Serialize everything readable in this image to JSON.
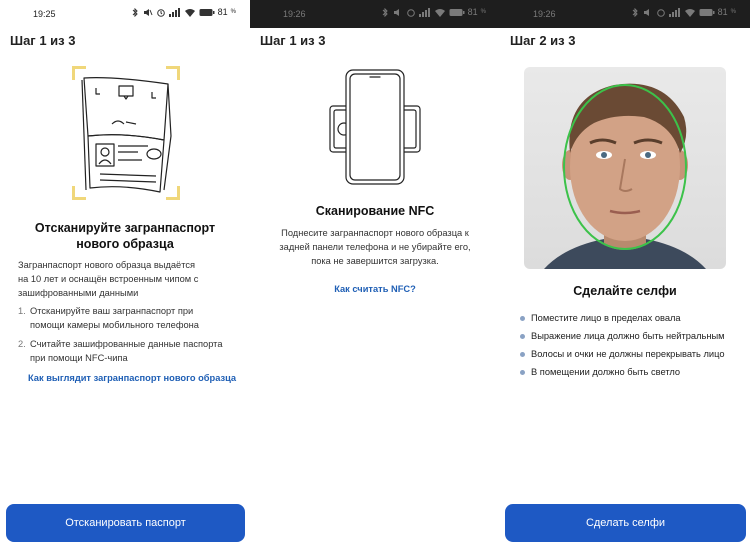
{
  "screens": [
    {
      "status": {
        "time": "19:25",
        "battery": "81"
      },
      "step": "Шаг 1 из 3",
      "heading_line1": "Отсканируйте загранпаспорт",
      "heading_line2": "нового образца",
      "desc": [
        "Загранпаспорт нового образца выдаётся",
        "на 10 лет и оснащён встроенным чипом с",
        "зашифрованными данными"
      ],
      "list": [
        {
          "num": "1.",
          "lines": [
            "Отсканируйте ваш загранпаспорт при",
            "помощи камеры мобильного телефона"
          ]
        },
        {
          "num": "2.",
          "lines": [
            "Считайте зашифрованные данные паспорта",
            "при помощи NFC-чипа"
          ]
        }
      ],
      "link": "Как выглядит загранпаспорт нового образца",
      "button": "Отсканировать паспорт"
    },
    {
      "status": {
        "time": "19:26",
        "battery": "81"
      },
      "step": "Шаг 1 из 3",
      "heading": "Сканирование NFC",
      "desc": [
        "Поднесите загранпаспорт нового образца к",
        "задней панели телефона и не убирайте его,",
        "пока не завершится загрузка."
      ],
      "link": "Как считать NFC?"
    },
    {
      "status": {
        "time": "19:26",
        "battery": "81"
      },
      "step": "Шаг 2 из 3",
      "heading": "Сделайте селфи",
      "bullets": [
        "Поместите лицо в пределах овала",
        "Выражение лица должно быть нейтральным",
        "Волосы и очки не должны перекрывать лицо",
        "В помещении должно быть светло"
      ],
      "button": "Сделать селфи"
    }
  ],
  "colors": {
    "accent": "#1e59c4",
    "link": "#1f5fb5",
    "oval": "#3cc24a",
    "frame_corner": "#f0d77a"
  }
}
